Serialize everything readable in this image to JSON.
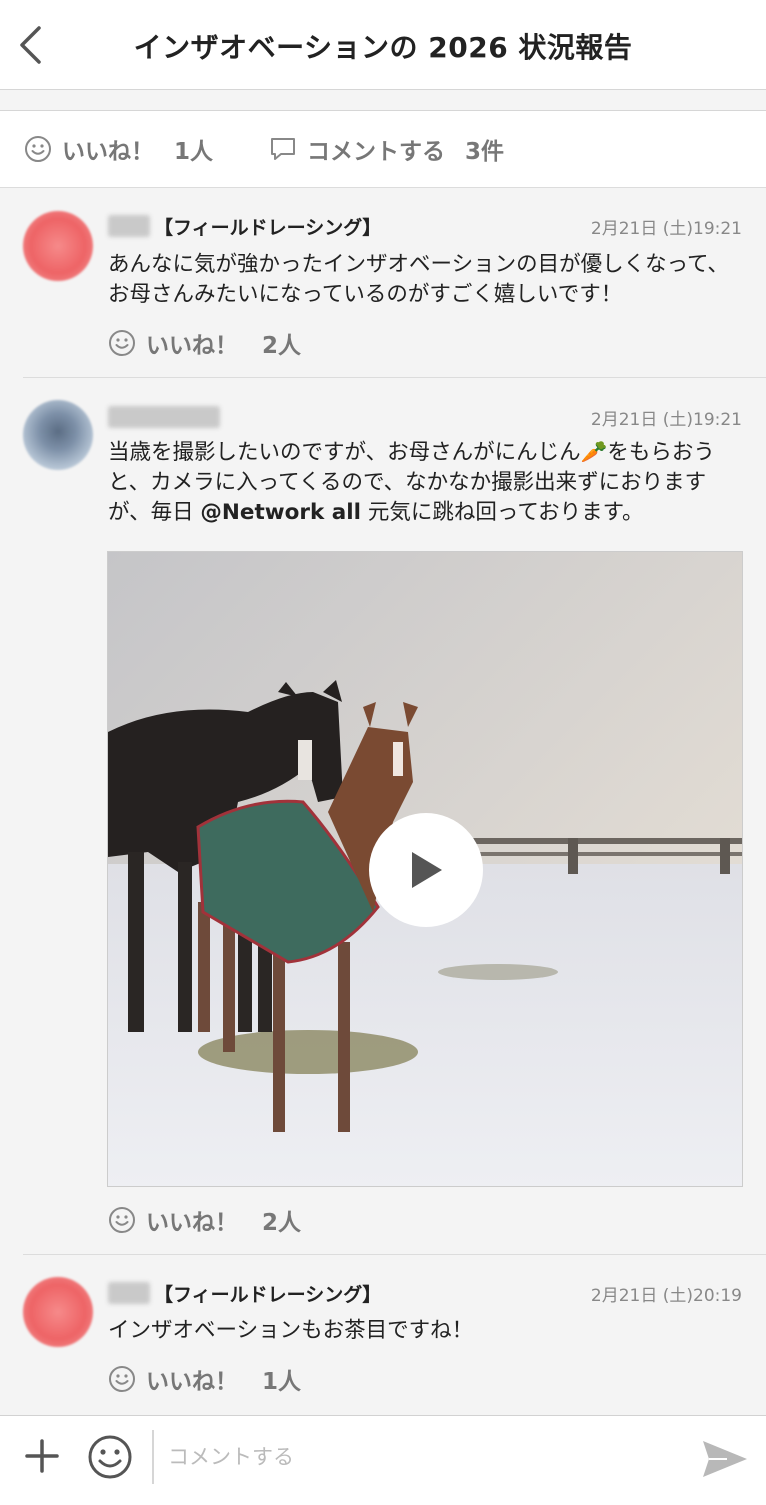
{
  "header": {
    "title": "インザオベーションの 2026 状況報告"
  },
  "summary": {
    "like_label": "いいね！",
    "like_count": "1人",
    "comment_label": "コメントする",
    "comment_count": "3件"
  },
  "comments": [
    {
      "org": "【フィールドレーシング】",
      "date": "2月21日 (土)19:21",
      "text": "あんなに気が強かったインザオベーションの目が優しくなって、お母さんみたいになっているのがすごく嬉しいです！",
      "like_label": "いいね！",
      "like_count": "2人"
    },
    {
      "org": "",
      "date": "2月21日 (土)19:21",
      "text_before_emoji": "当歳を撮影したいのですが、お母さんがにんじん",
      "emoji": "🥕",
      "text_after_emoji": "をもらおうと、カメラに入ってくるので、なかなか撮影出来ずにおりますが、毎日",
      "mention": "@Network all",
      "text_end": "元気に跳ね回っております。",
      "like_label": "いいね！",
      "like_count": "2人"
    },
    {
      "org": "【フィールドレーシング】",
      "date": "2月21日 (土)20:19",
      "text": "インザオベーションもお茶目ですね！",
      "like_label": "いいね！",
      "like_count": "1人"
    }
  ],
  "input": {
    "placeholder": "コメントする"
  },
  "icons": {
    "back": "chevron-left-icon",
    "like": "smiley-icon",
    "comment": "speech-bubble-icon",
    "play": "play-icon",
    "plus": "plus-icon",
    "emoji": "emoji-icon",
    "send": "send-icon"
  },
  "colors": {
    "muted": "#777777",
    "date": "#888888",
    "background": "#f4f4f4"
  }
}
